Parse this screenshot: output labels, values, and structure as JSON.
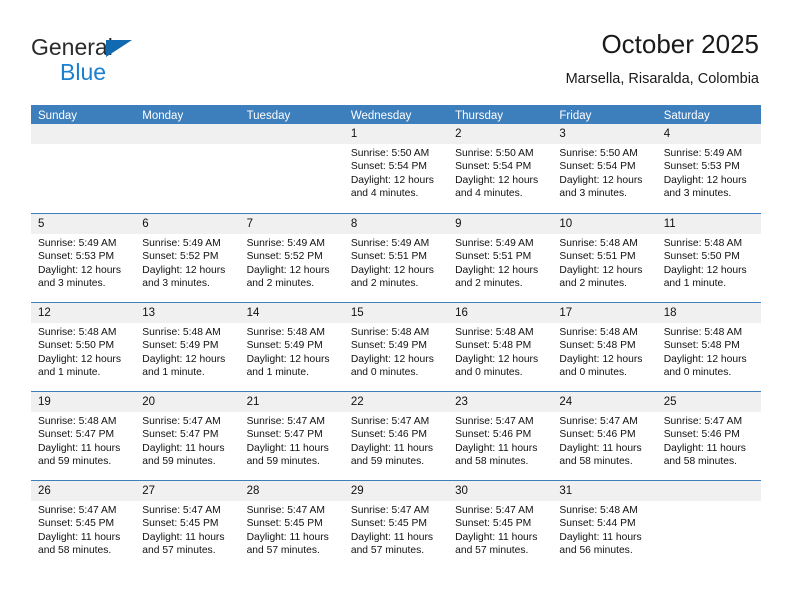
{
  "brand": {
    "name_part1": "General",
    "name_part2": "Blue",
    "triangle_color": "#1169b0",
    "blue_color": "#1a80d0"
  },
  "header": {
    "title": "October 2025",
    "subtitle": "Marsella, Risaralda, Colombia"
  },
  "theme": {
    "header_blue": "#3d7ebd",
    "daynum_bg": "#f0f0f0",
    "text": "#111111"
  },
  "weekdays": [
    "Sunday",
    "Monday",
    "Tuesday",
    "Wednesday",
    "Thursday",
    "Friday",
    "Saturday"
  ],
  "weeks": [
    [
      {
        "day": "",
        "empty": true
      },
      {
        "day": "",
        "empty": true
      },
      {
        "day": "",
        "empty": true
      },
      {
        "day": "1",
        "sunrise": "Sunrise: 5:50 AM",
        "sunset": "Sunset: 5:54 PM",
        "daylight": "Daylight: 12 hours and 4 minutes."
      },
      {
        "day": "2",
        "sunrise": "Sunrise: 5:50 AM",
        "sunset": "Sunset: 5:54 PM",
        "daylight": "Daylight: 12 hours and 4 minutes."
      },
      {
        "day": "3",
        "sunrise": "Sunrise: 5:50 AM",
        "sunset": "Sunset: 5:54 PM",
        "daylight": "Daylight: 12 hours and 3 minutes."
      },
      {
        "day": "4",
        "sunrise": "Sunrise: 5:49 AM",
        "sunset": "Sunset: 5:53 PM",
        "daylight": "Daylight: 12 hours and 3 minutes."
      }
    ],
    [
      {
        "day": "5",
        "sunrise": "Sunrise: 5:49 AM",
        "sunset": "Sunset: 5:53 PM",
        "daylight": "Daylight: 12 hours and 3 minutes."
      },
      {
        "day": "6",
        "sunrise": "Sunrise: 5:49 AM",
        "sunset": "Sunset: 5:52 PM",
        "daylight": "Daylight: 12 hours and 3 minutes."
      },
      {
        "day": "7",
        "sunrise": "Sunrise: 5:49 AM",
        "sunset": "Sunset: 5:52 PM",
        "daylight": "Daylight: 12 hours and 2 minutes."
      },
      {
        "day": "8",
        "sunrise": "Sunrise: 5:49 AM",
        "sunset": "Sunset: 5:51 PM",
        "daylight": "Daylight: 12 hours and 2 minutes."
      },
      {
        "day": "9",
        "sunrise": "Sunrise: 5:49 AM",
        "sunset": "Sunset: 5:51 PM",
        "daylight": "Daylight: 12 hours and 2 minutes."
      },
      {
        "day": "10",
        "sunrise": "Sunrise: 5:48 AM",
        "sunset": "Sunset: 5:51 PM",
        "daylight": "Daylight: 12 hours and 2 minutes."
      },
      {
        "day": "11",
        "sunrise": "Sunrise: 5:48 AM",
        "sunset": "Sunset: 5:50 PM",
        "daylight": "Daylight: 12 hours and 1 minute."
      }
    ],
    [
      {
        "day": "12",
        "sunrise": "Sunrise: 5:48 AM",
        "sunset": "Sunset: 5:50 PM",
        "daylight": "Daylight: 12 hours and 1 minute."
      },
      {
        "day": "13",
        "sunrise": "Sunrise: 5:48 AM",
        "sunset": "Sunset: 5:49 PM",
        "daylight": "Daylight: 12 hours and 1 minute."
      },
      {
        "day": "14",
        "sunrise": "Sunrise: 5:48 AM",
        "sunset": "Sunset: 5:49 PM",
        "daylight": "Daylight: 12 hours and 1 minute."
      },
      {
        "day": "15",
        "sunrise": "Sunrise: 5:48 AM",
        "sunset": "Sunset: 5:49 PM",
        "daylight": "Daylight: 12 hours and 0 minutes."
      },
      {
        "day": "16",
        "sunrise": "Sunrise: 5:48 AM",
        "sunset": "Sunset: 5:48 PM",
        "daylight": "Daylight: 12 hours and 0 minutes."
      },
      {
        "day": "17",
        "sunrise": "Sunrise: 5:48 AM",
        "sunset": "Sunset: 5:48 PM",
        "daylight": "Daylight: 12 hours and 0 minutes."
      },
      {
        "day": "18",
        "sunrise": "Sunrise: 5:48 AM",
        "sunset": "Sunset: 5:48 PM",
        "daylight": "Daylight: 12 hours and 0 minutes."
      }
    ],
    [
      {
        "day": "19",
        "sunrise": "Sunrise: 5:48 AM",
        "sunset": "Sunset: 5:47 PM",
        "daylight": "Daylight: 11 hours and 59 minutes."
      },
      {
        "day": "20",
        "sunrise": "Sunrise: 5:47 AM",
        "sunset": "Sunset: 5:47 PM",
        "daylight": "Daylight: 11 hours and 59 minutes."
      },
      {
        "day": "21",
        "sunrise": "Sunrise: 5:47 AM",
        "sunset": "Sunset: 5:47 PM",
        "daylight": "Daylight: 11 hours and 59 minutes."
      },
      {
        "day": "22",
        "sunrise": "Sunrise: 5:47 AM",
        "sunset": "Sunset: 5:46 PM",
        "daylight": "Daylight: 11 hours and 59 minutes."
      },
      {
        "day": "23",
        "sunrise": "Sunrise: 5:47 AM",
        "sunset": "Sunset: 5:46 PM",
        "daylight": "Daylight: 11 hours and 58 minutes."
      },
      {
        "day": "24",
        "sunrise": "Sunrise: 5:47 AM",
        "sunset": "Sunset: 5:46 PM",
        "daylight": "Daylight: 11 hours and 58 minutes."
      },
      {
        "day": "25",
        "sunrise": "Sunrise: 5:47 AM",
        "sunset": "Sunset: 5:46 PM",
        "daylight": "Daylight: 11 hours and 58 minutes."
      }
    ],
    [
      {
        "day": "26",
        "sunrise": "Sunrise: 5:47 AM",
        "sunset": "Sunset: 5:45 PM",
        "daylight": "Daylight: 11 hours and 58 minutes."
      },
      {
        "day": "27",
        "sunrise": "Sunrise: 5:47 AM",
        "sunset": "Sunset: 5:45 PM",
        "daylight": "Daylight: 11 hours and 57 minutes."
      },
      {
        "day": "28",
        "sunrise": "Sunrise: 5:47 AM",
        "sunset": "Sunset: 5:45 PM",
        "daylight": "Daylight: 11 hours and 57 minutes."
      },
      {
        "day": "29",
        "sunrise": "Sunrise: 5:47 AM",
        "sunset": "Sunset: 5:45 PM",
        "daylight": "Daylight: 11 hours and 57 minutes."
      },
      {
        "day": "30",
        "sunrise": "Sunrise: 5:47 AM",
        "sunset": "Sunset: 5:45 PM",
        "daylight": "Daylight: 11 hours and 57 minutes."
      },
      {
        "day": "31",
        "sunrise": "Sunrise: 5:48 AM",
        "sunset": "Sunset: 5:44 PM",
        "daylight": "Daylight: 11 hours and 56 minutes."
      },
      {
        "day": "",
        "empty": true
      }
    ]
  ]
}
